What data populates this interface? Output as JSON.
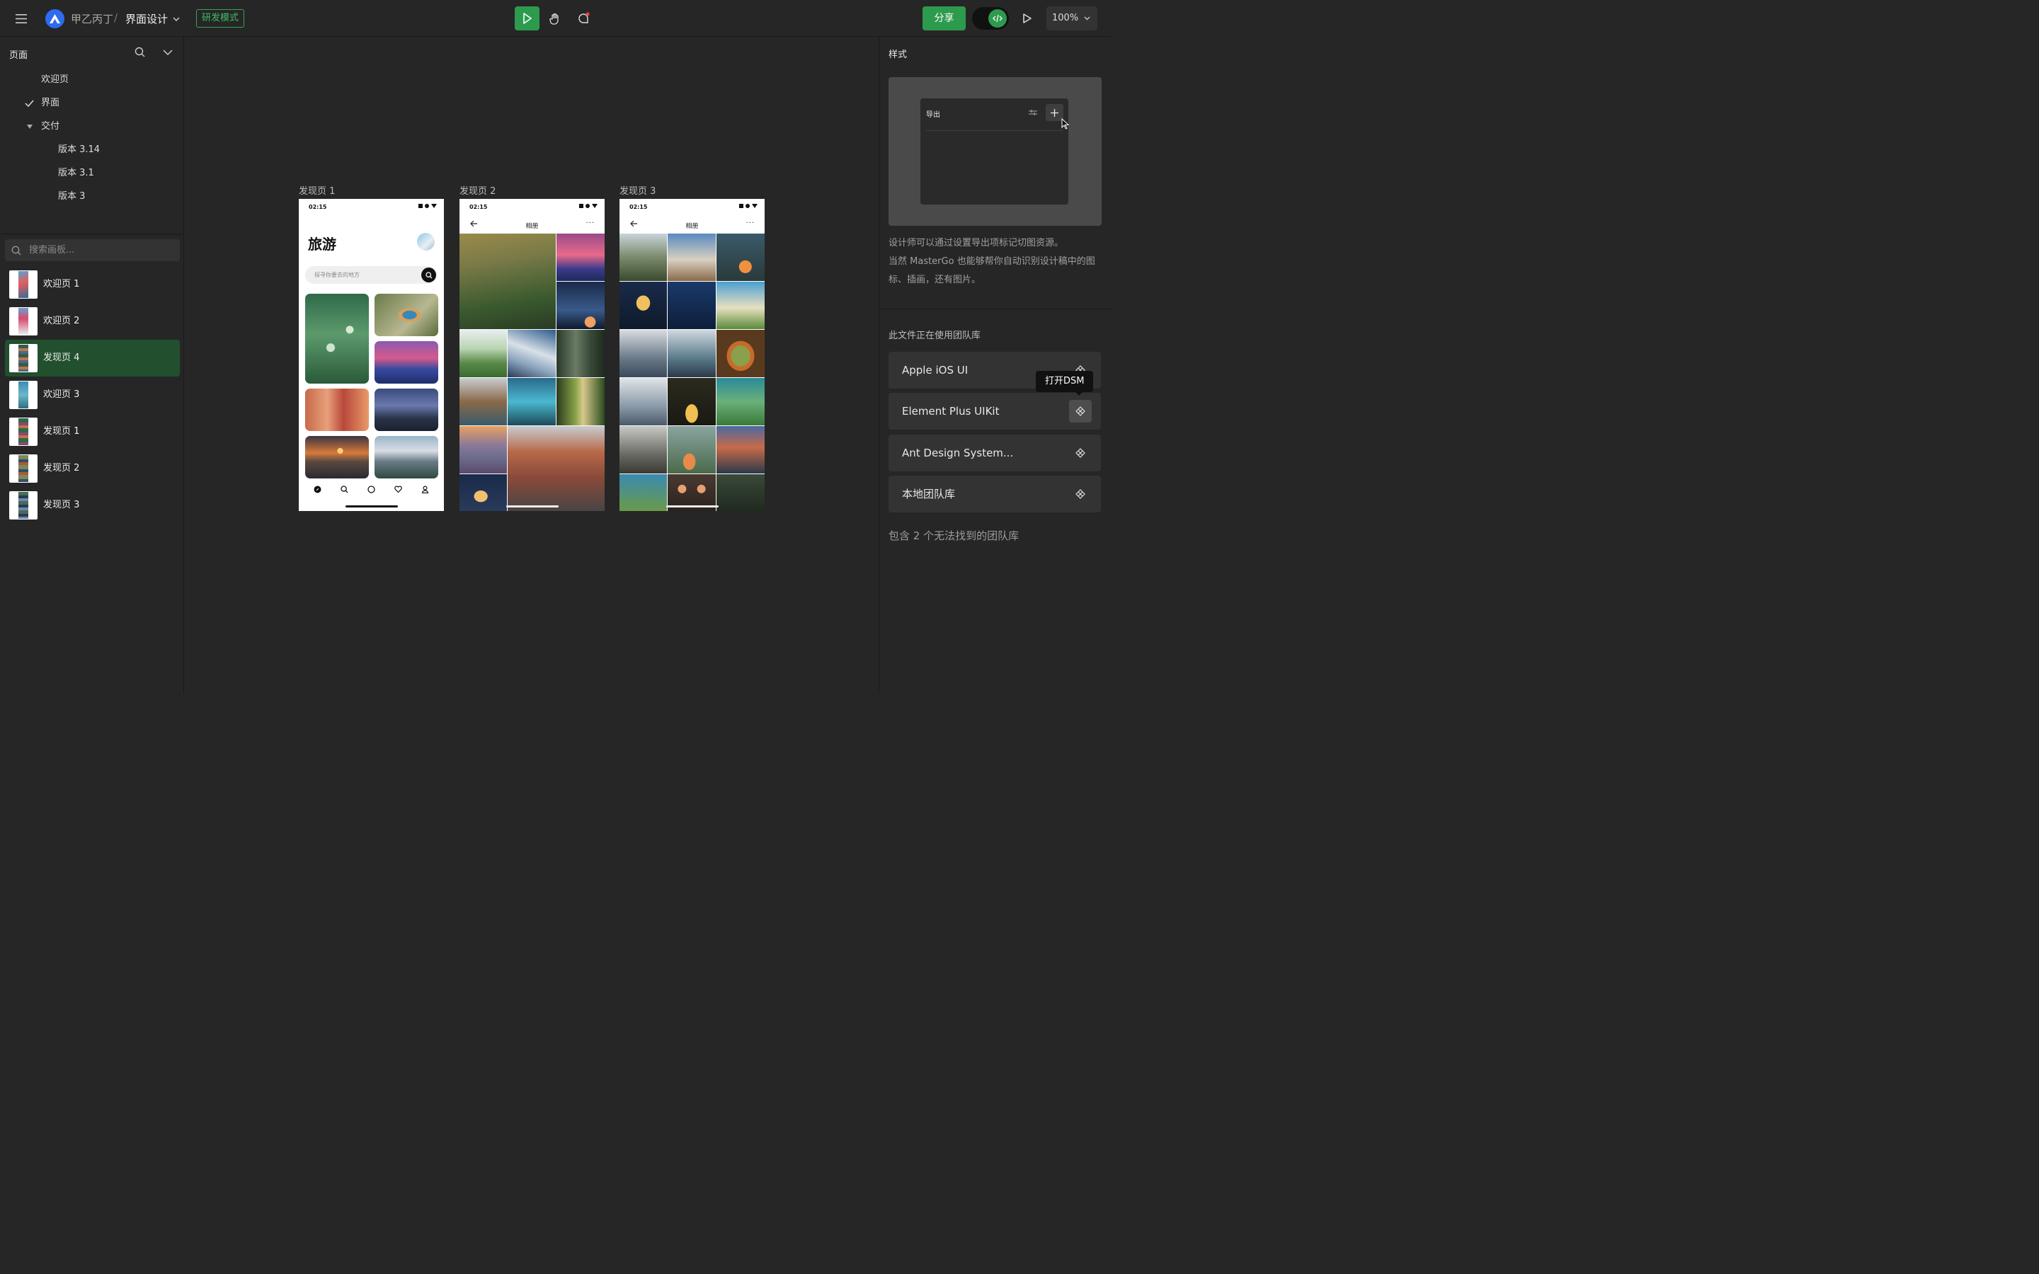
{
  "topbar": {
    "team": "甲乙丙丁",
    "separator": "/",
    "file": "界面设计",
    "dev_mode": "研发模式",
    "share": "分享",
    "zoom": "100%",
    "colors": {
      "accent": "#2d9b4e",
      "logo": "#2f6bf0"
    },
    "icons": [
      "menu-icon",
      "logo-icon",
      "chevron-down-icon",
      "move-tool-icon",
      "hand-tool-icon",
      "comment-tool-icon",
      "code-icon",
      "play-icon"
    ]
  },
  "pages": {
    "title": "页面",
    "items": [
      {
        "label": "欢迎页"
      },
      {
        "label": "界面",
        "checked": true
      },
      {
        "label": "交付",
        "expanded": true
      },
      {
        "label": "版本 3.14"
      },
      {
        "label": "版本 3.1"
      },
      {
        "label": "版本 3"
      }
    ]
  },
  "boards": {
    "search_placeholder": "搜索画板...",
    "items": [
      {
        "label": "欢迎页 1"
      },
      {
        "label": "欢迎页 2"
      },
      {
        "label": "发现页 4",
        "selected": true
      },
      {
        "label": "欢迎页 3"
      },
      {
        "label": "发现页 1"
      },
      {
        "label": "发现页 2"
      },
      {
        "label": "发现页 3"
      }
    ]
  },
  "canvas": {
    "frames": [
      {
        "label": "发现页 1",
        "time": "02:15",
        "title": "旅游",
        "search_placeholder": "探寻你要去的地方"
      },
      {
        "label": "发现页 2",
        "time": "02:15",
        "header": "相册",
        "more": "···"
      },
      {
        "label": "发现页 3",
        "time": "02:15",
        "header": "相册",
        "more": "···"
      }
    ]
  },
  "style_panel": {
    "title": "样式",
    "export_label": "导出",
    "description": [
      "设计师可以通过设置导出项标记切图资源。",
      "当然 MasterGo 也能够帮你自动识别设计稿中的图标、插画，还有图片。"
    ],
    "libraries_title": "此文件正在使用团队库",
    "libraries": [
      {
        "name": "Apple iOS UI"
      },
      {
        "name": "Element Plus UIKit"
      },
      {
        "name": "Ant Design System..."
      },
      {
        "name": "本地团队库"
      }
    ],
    "tooltip": "打开DSM",
    "missing": "包含 2 个无法找到的团队库"
  }
}
